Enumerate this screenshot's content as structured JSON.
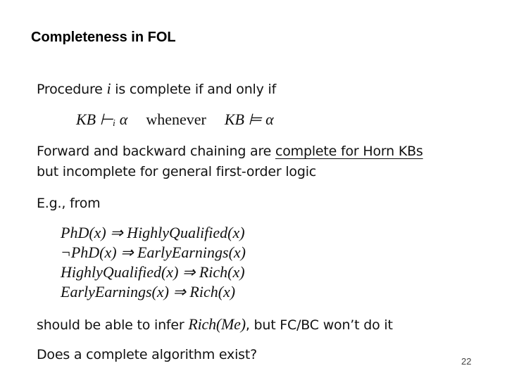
{
  "slide": {
    "title": "Completeness in FOL",
    "page_number": "22",
    "para1": {
      "prefix": "Procedure ",
      "var": "i",
      "suffix": " is complete if and only if"
    },
    "definition": {
      "lhs": "KB ⊢ᵢ α",
      "word": "whenever",
      "rhs": "KB ⊨ α"
    },
    "para2": {
      "line1_prefix": "Forward and backward chaining are ",
      "line1_underlined": "complete for Horn KBs",
      "line2": "but incomplete for general first-order logic"
    },
    "para3": "E.g., from",
    "rules": [
      "PhD(x) ⇒ HighlyQualified(x)",
      "¬PhD(x) ⇒ EarlyEarnings(x)",
      "HighlyQualified(x) ⇒ Rich(x)",
      "EarlyEarnings(x) ⇒ Rich(x)"
    ],
    "para4": {
      "prefix": "should be able to infer ",
      "math": "Rich(Me)",
      "suffix": ", but FC/BC won’t do it"
    },
    "para5": "Does a complete algorithm exist?"
  }
}
